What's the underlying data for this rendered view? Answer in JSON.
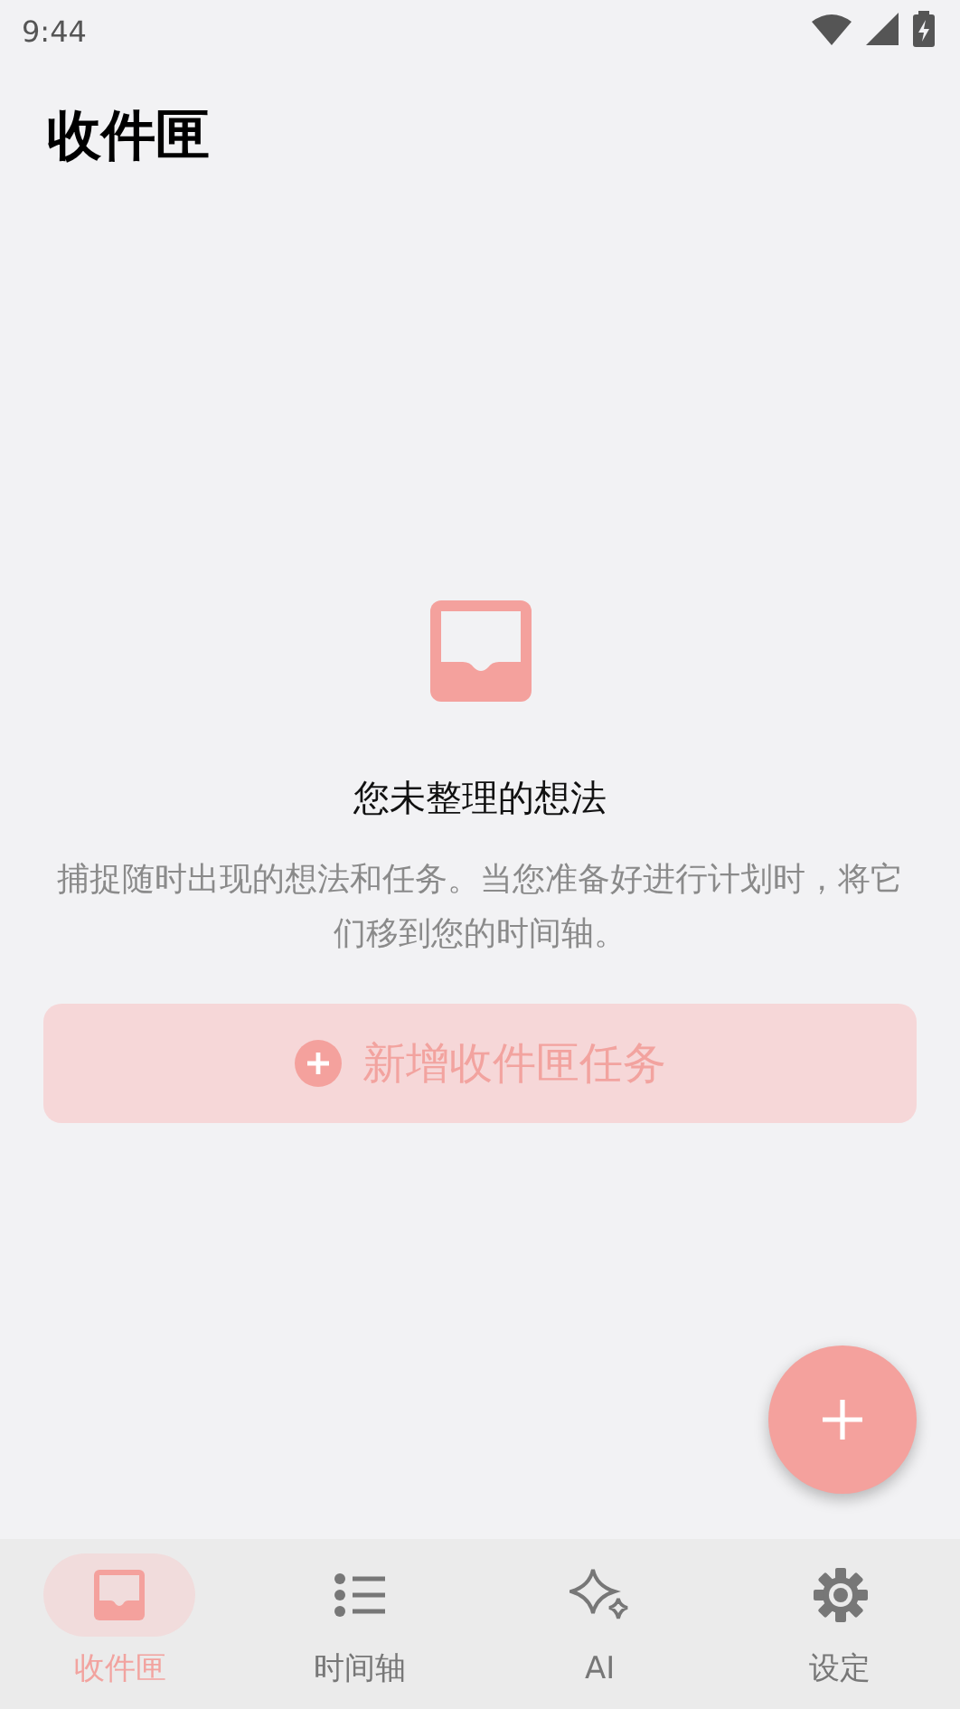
{
  "status_bar": {
    "time": "9:44"
  },
  "header": {
    "title": "收件匣"
  },
  "empty_state": {
    "heading": "您未整理的想法",
    "description": "捕捉随时出现的想法和任务。当您准备好进行计划时，将它们移到您的时间轴。",
    "button": "新增收件匣任务"
  },
  "bottom_nav": [
    {
      "label": "收件匣",
      "selected": true
    },
    {
      "label": "时间轴",
      "selected": false
    },
    {
      "label": "AI",
      "selected": false
    },
    {
      "label": "设定",
      "selected": false
    }
  ]
}
